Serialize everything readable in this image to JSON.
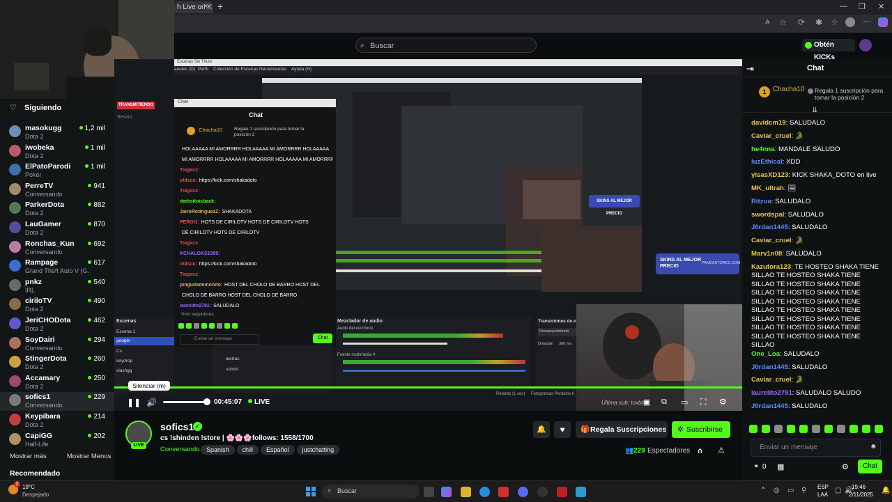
{
  "browser": {
    "tab_title": "h Live on K",
    "tab_close": "×",
    "new_tab": "+"
  },
  "kick": {
    "search_placeholder": "Buscar",
    "kicks_button": "Obtén KICKs"
  },
  "sidebar": {
    "following_label": "Siguiendo",
    "channels": [
      {
        "name": "masokugg",
        "sub": "Dota 2",
        "viewers": "1,2 mil",
        "color": "#6b8fb8"
      },
      {
        "name": "iwobeka",
        "sub": "Dota 2",
        "viewers": "1 mil",
        "color": "#b85c6b"
      },
      {
        "name": "ElPatoParodi",
        "sub": "Poker",
        "viewers": "1 mil",
        "color": "#3f6fae"
      },
      {
        "name": "PerreTV",
        "sub": "Conversando",
        "viewers": "941",
        "color": "#a38a6b"
      },
      {
        "name": "ParkerDota",
        "sub": "Dota 2",
        "viewers": "882",
        "color": "#4e7a54"
      },
      {
        "name": "LauGamer",
        "sub": "Dota 2",
        "viewers": "870",
        "color": "#5a4a9a"
      },
      {
        "name": "Ronchas_Kun",
        "sub": "Conversando",
        "viewers": "692",
        "color": "#c07aa0"
      },
      {
        "name": "Rampage",
        "sub": "Grand Theft Auto V (G...",
        "viewers": "617",
        "color": "#3a6fd0"
      },
      {
        "name": "pnkz",
        "sub": "IRL",
        "viewers": "540",
        "color": "#6a6a6a"
      },
      {
        "name": "ciriloTV",
        "sub": "Dota 2",
        "viewers": "490",
        "color": "#8a6a4a"
      },
      {
        "name": "JeriCHODota",
        "sub": "Dota 2",
        "viewers": "462",
        "color": "#5a5ad0"
      },
      {
        "name": "SoyDairi",
        "sub": "Conversando",
        "viewers": "294",
        "color": "#b07060"
      },
      {
        "name": "StingerDota",
        "sub": "Dota 2",
        "viewers": "260",
        "color": "#d0a040"
      },
      {
        "name": "Accamary",
        "sub": "Dota 2",
        "viewers": "250",
        "color": "#9a4a6a"
      },
      {
        "name": "sofics1",
        "sub": "Conversando",
        "viewers": "229",
        "color": "#7a7a7a"
      },
      {
        "name": "Keypibara",
        "sub": "Dota 2",
        "viewers": "214",
        "color": "#c04040"
      },
      {
        "name": "CapiGG",
        "sub": "Half-Life",
        "viewers": "202",
        "color": "#b09060"
      }
    ],
    "show_more": "Mostrar más",
    "show_less": "Mostrar Menos",
    "recommended": "Recomendado"
  },
  "video": {
    "obs_menu": [
      "aneles (D)",
      "Perfil",
      "Colección de Escenas",
      "Herramientas",
      "Ayuda (H)"
    ],
    "obs_title": "Escenas Sin Título",
    "inner_chat_title": "Chat",
    "inner_chat_tab": "Chat",
    "inner_top_user": "Chacha10",
    "inner_top_text": "Regala 1 suscripción para tomar la posición 2",
    "inner_lines": [
      {
        "u": "",
        "t": "HOLAAAAA MI AMORRRR HOLAAAAA MI AMORRRR HOLAAAAA",
        "c": "#fff"
      },
      {
        "u": "",
        "t": "MI AMORRRR HOLAAAAA MI AMORRRR HOLAAAAA MI AMORRRR",
        "c": "#fff"
      },
      {
        "u": "Tiagxcx:",
        "t": "",
        "c": "#e05050"
      },
      {
        "u": "oldsco:",
        "t": "https://kick.com/shakadoto",
        "c": "#e05050"
      },
      {
        "u": "Tiagxcx:",
        "t": "",
        "c": "#e05050"
      },
      {
        "u": "darksitoisback:",
        "t": "",
        "c": "#53fc18"
      },
      {
        "u": "JairoRodriguezZ:",
        "t": "SHAKADOTA",
        "c": "#e0b050"
      },
      {
        "u": "PEROO:",
        "t": "HOTS DE CIRILOTV  HOTS DE CIRILOTV  HOTS",
        "c": "#e05050"
      },
      {
        "u": "",
        "t": "DE CIRILOTV  HOTS DE CIRILOTV",
        "c": "#fff"
      },
      {
        "u": "Tiagxcx:",
        "t": "",
        "c": "#e05050"
      },
      {
        "u": "KCHALOKS1999:",
        "t": "",
        "c": "#9a6af0"
      },
      {
        "u": "oldsco:",
        "t": "https://kick.com/shakadoto",
        "c": "#e05050"
      },
      {
        "u": "Tiagxcx:",
        "t": "",
        "c": "#e05050"
      },
      {
        "u": "pinguitademonito:",
        "t": "HOST DEL CHOLO DE BARRO  HOST DEL",
        "c": "#e0b050"
      },
      {
        "u": "",
        "t": "CHOLO DE BARRO  HOST DEL CHOLO DE BARRO",
        "c": "#fff"
      },
      {
        "u": "laurelito2791:",
        "t": "SALUDALO",
        "c": "#9a6af0"
      }
    ],
    "inner_followers": "Solo seguidores",
    "inner_input_placeholder": "Enviar un mensaje",
    "inner_chat_button": "Chat",
    "scenes_label": "Escenas",
    "scenes": [
      "Escena 1",
      "google",
      "Cs",
      "keydrop",
      "clashgg"
    ],
    "sources": [
      "alertas",
      "subsis"
    ],
    "mixer_label": "Mezclador de audio",
    "mixer_desktop": "Audio del escritorio",
    "mixer_media": "Fuente multimedia 4",
    "transitions_label": "Transiciones de e",
    "transition_value": "Desvanecimiento",
    "duration_label": "Duración",
    "duration_value": "300 ms",
    "status_delay": "Retardo (1 sec)",
    "status_frames": "Fotogramas Perdidos 0",
    "skins_ad": "SKINS AL MEJOR PRECIO",
    "skins_site": "PANDASTORES.COM",
    "ultima_sub": "Última sub: toxbito",
    "transmitting": "TRANSMITIENDO",
    "session": "Sesión",
    "tooltip": "Silenciar (m)",
    "time": "00:45:07",
    "live": "LIVE"
  },
  "stream": {
    "streamer": "sofics1",
    "title": "cs !shinden !store | 🌸🌸🌸follows: 1558/1700",
    "category": "Conversando",
    "tags": [
      "Spanish",
      "chill",
      "Español",
      "justchatting"
    ],
    "gift_button": "Regala Suscripciones",
    "subscribe_button": "Suscribirse",
    "viewers_count": "229",
    "viewers_label": "Espectadores",
    "live_badge": "LIVE"
  },
  "chat": {
    "title": "Chat",
    "top_user": "Chacha10",
    "top_text": "Regala 1 suscripción para tomar la posición 2",
    "messages": [
      {
        "user": "davidcm19",
        "text": "SALUDALO",
        "color": "#e8c64a"
      },
      {
        "user": "Caviar_cruel",
        "text": "🐊",
        "color": "#e8c64a"
      },
      {
        "user": "he4nna",
        "text": "MANDALE SALUDO",
        "color": "#53fc18"
      },
      {
        "user": "luzEthical",
        "text": "XDD",
        "color": "#5b8cff"
      },
      {
        "user": "yisasXD123",
        "text": "KICK SHAKA_DOTO en live",
        "color": "#e8c64a"
      },
      {
        "user": "MK_ultrah",
        "text": "🖼",
        "color": "#e8c64a"
      },
      {
        "user": "Ritzua",
        "text": "SALUDALO",
        "color": "#5b8cff"
      },
      {
        "user": "swordspal",
        "text": "SALUDALO",
        "color": "#e8c64a"
      },
      {
        "user": "J0rdan1445",
        "text": "SALUDALO",
        "color": "#5b8cff"
      },
      {
        "user": "Caviar_cruel",
        "text": "🐊",
        "color": "#e8c64a"
      },
      {
        "user": "Marv1n08",
        "text": "SALUDALO",
        "color": "#e8c64a"
      },
      {
        "user": "Kazutora123",
        "text": "TE HOSTEO SHAKA TIENE SILLAO TE HOSTEO SHAKA TIENE SILLAO TE HOSTEO SHAKA TIENE SILLAO TE HOSTEO SHAKA TIENE SILLAO TE HOSTEO SHAKA TIENE SILLAO TE HOSTEO SHAKA TIENE SILLAO TE HOSTEO SHAKA TIENE SILLAO TE HOSTEO SHAKA TIENE SILLAO TE HOSTEO SHAKA TIENE SILLAO",
        "color": "#e8c64a"
      },
      {
        "user": "One_Loa",
        "text": "SALUDALO",
        "color": "#53fc18"
      },
      {
        "user": "J0rdan1445",
        "text": "SALUDALO",
        "color": "#5b8cff"
      },
      {
        "user": "Caviar_cruel",
        "text": "🐊",
        "color": "#e8c64a"
      },
      {
        "user": "laurelito2791",
        "text": "SALUDALO SALUDO",
        "color": "#9a6af0"
      },
      {
        "user": "J0rdan1445",
        "text": "SALUDALO",
        "color": "#5b8cff"
      }
    ],
    "input_placeholder": "Enviar un mensaje",
    "kicks_count": "0",
    "chat_button": "Chat"
  },
  "taskbar": {
    "weather_temp": "19°C",
    "weather_text": "Despejado",
    "weather_badge": "2",
    "search": "Buscar",
    "lang_top": "ESP",
    "lang_bottom": "LAA",
    "time": "19:46",
    "date": "2/11/2025"
  },
  "colors": {
    "kick_green": "#53fc18",
    "bg": "#0b0e0f",
    "panel": "#131617"
  }
}
